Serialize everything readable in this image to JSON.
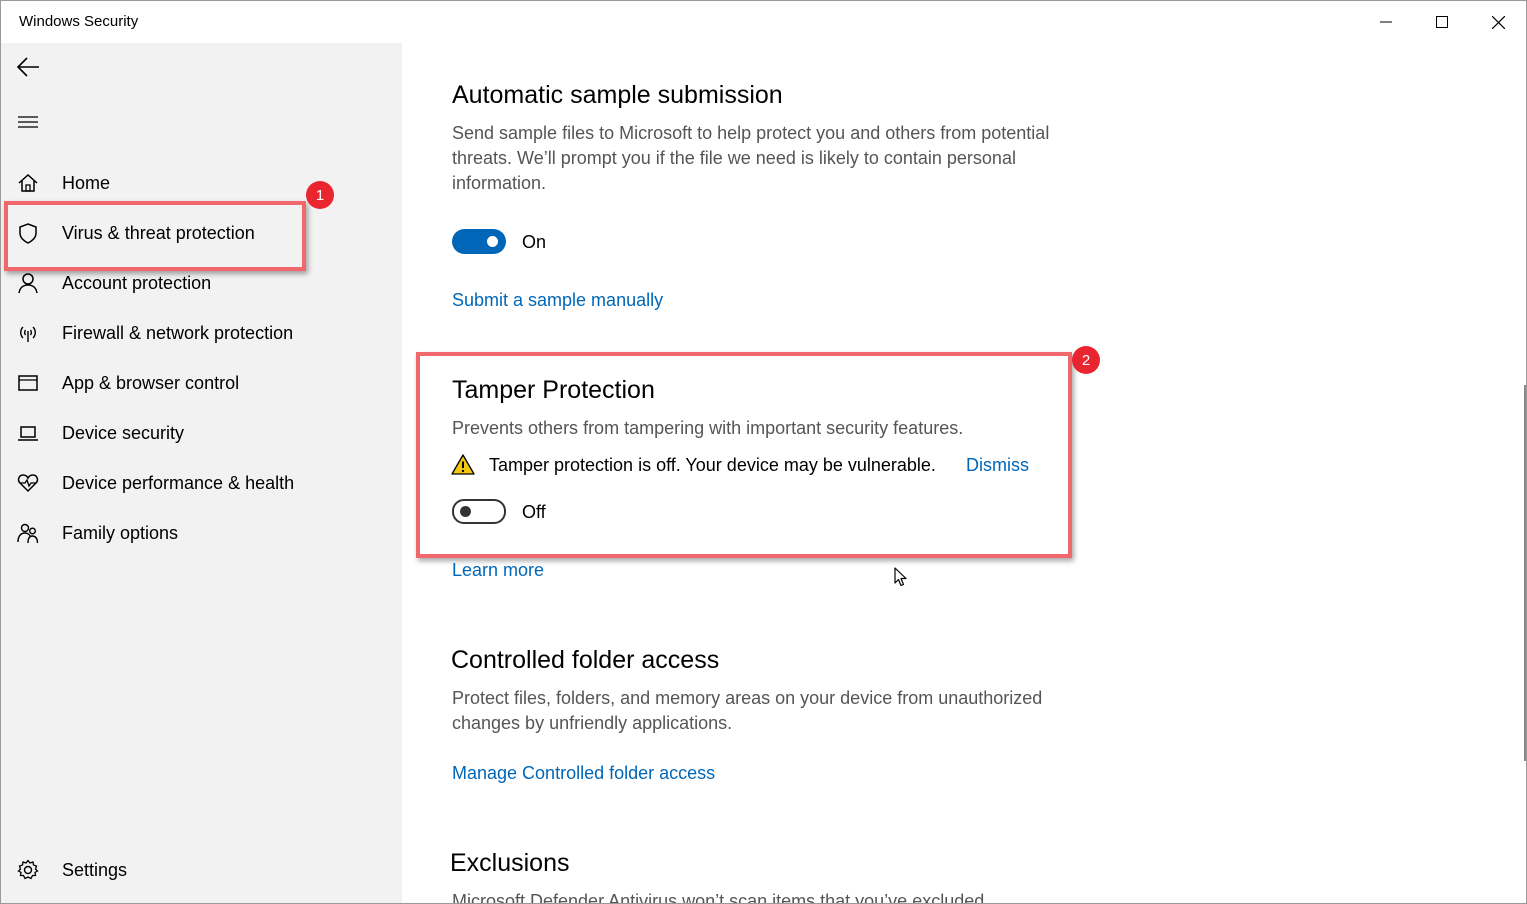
{
  "window": {
    "title": "Windows Security"
  },
  "sidebar": {
    "items": [
      {
        "label": "Home",
        "icon": "home-icon"
      },
      {
        "label": "Virus & threat protection",
        "icon": "shield-icon"
      },
      {
        "label": "Account protection",
        "icon": "person-icon"
      },
      {
        "label": "Firewall & network protection",
        "icon": "wireless-icon"
      },
      {
        "label": "App & browser control",
        "icon": "browser-window-icon"
      },
      {
        "label": "Device security",
        "icon": "laptop-icon"
      },
      {
        "label": "Device performance & health",
        "icon": "heart-pulse-icon"
      },
      {
        "label": "Family options",
        "icon": "family-icon"
      }
    ],
    "settings_label": "Settings"
  },
  "main": {
    "sample": {
      "title": "Automatic sample submission",
      "description": "Send sample files to Microsoft to help protect you and others from potential threats. We’ll prompt you if the file we need is likely to contain personal information.",
      "toggle_state": "On",
      "link": "Submit a sample manually"
    },
    "tamper": {
      "title": "Tamper Protection",
      "description": "Prevents others from tampering with important security features.",
      "warning": "Tamper protection is off. Your device may be vulnerable.",
      "dismiss": "Dismiss",
      "toggle_state": "Off",
      "link": "Learn more"
    },
    "cfa": {
      "title": "Controlled folder access",
      "description": "Protect files, folders, and memory areas on your device from unauthorized changes by unfriendly applications.",
      "link": "Manage Controlled folder access"
    },
    "exclusions": {
      "title": "Exclusions",
      "description": "Microsoft Defender Antivirus won’t scan items that you’ve excluded."
    }
  },
  "annotations": {
    "badge1": "1",
    "badge2": "2",
    "color": "#f0676e",
    "badge_color": "#e9262f"
  },
  "colors": {
    "accent": "#0067b8",
    "sidebar_bg": "#f2f2f2",
    "warning": "#f2c811"
  }
}
